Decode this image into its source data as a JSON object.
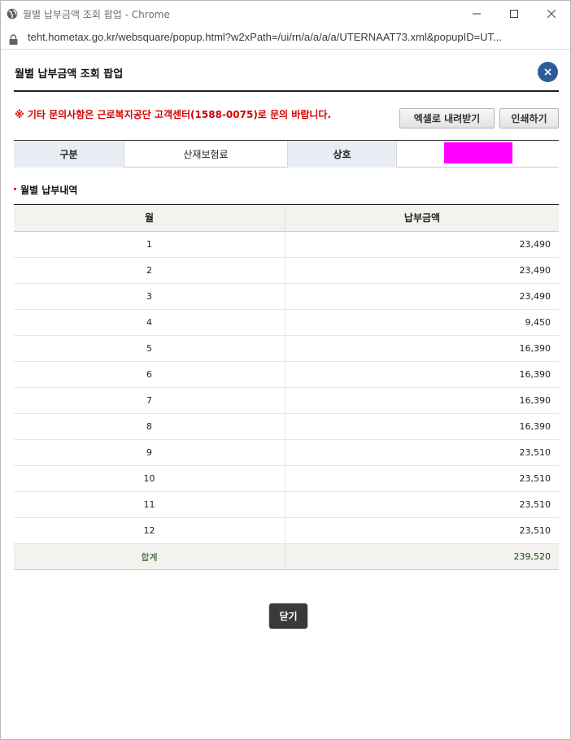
{
  "window": {
    "title": "월별 납부금액 조회 팝업 - Chrome",
    "url": "teht.hometax.go.kr/websquare/popup.html?w2xPath=/ui/rn/a/a/a/a/UTERNAAT73.xml&popupID=UT..."
  },
  "popup": {
    "title": "월별 납부금액 조회 팝업",
    "notice": "※ 기타 문의사항은 근로복지공단 고객센터(1588-0075)로 문의 바랍니다.",
    "excel_button": "엑셀로 내려받기",
    "print_button": "인쇄하기",
    "close_button": "닫기"
  },
  "info": {
    "type_label": "구분",
    "type_value": "산재보험료",
    "company_label": "상호",
    "company_value": ""
  },
  "monthly": {
    "section_title": "월별 납부내역",
    "headers": [
      "월",
      "납부금액"
    ],
    "rows": [
      {
        "month": "1",
        "amount": "23,490"
      },
      {
        "month": "2",
        "amount": "23,490"
      },
      {
        "month": "3",
        "amount": "23,490"
      },
      {
        "month": "4",
        "amount": "9,450"
      },
      {
        "month": "5",
        "amount": "16,390"
      },
      {
        "month": "6",
        "amount": "16,390"
      },
      {
        "month": "7",
        "amount": "16,390"
      },
      {
        "month": "8",
        "amount": "16,390"
      },
      {
        "month": "9",
        "amount": "23,510"
      },
      {
        "month": "10",
        "amount": "23,510"
      },
      {
        "month": "11",
        "amount": "23,510"
      },
      {
        "month": "12",
        "amount": "23,510"
      }
    ],
    "total_label": "합계",
    "total_amount": "239,520"
  },
  "colors": {
    "notice": "#d40000",
    "close_circle": "#2c5d9a",
    "redaction": "#ff00ff",
    "header_bg": "#e8edf4",
    "table_head_bg": "#f4f2ef"
  },
  "icons": [
    "globe-icon",
    "minimize-icon",
    "maximize-icon",
    "close-icon",
    "lock-icon",
    "popup-close-icon"
  ]
}
